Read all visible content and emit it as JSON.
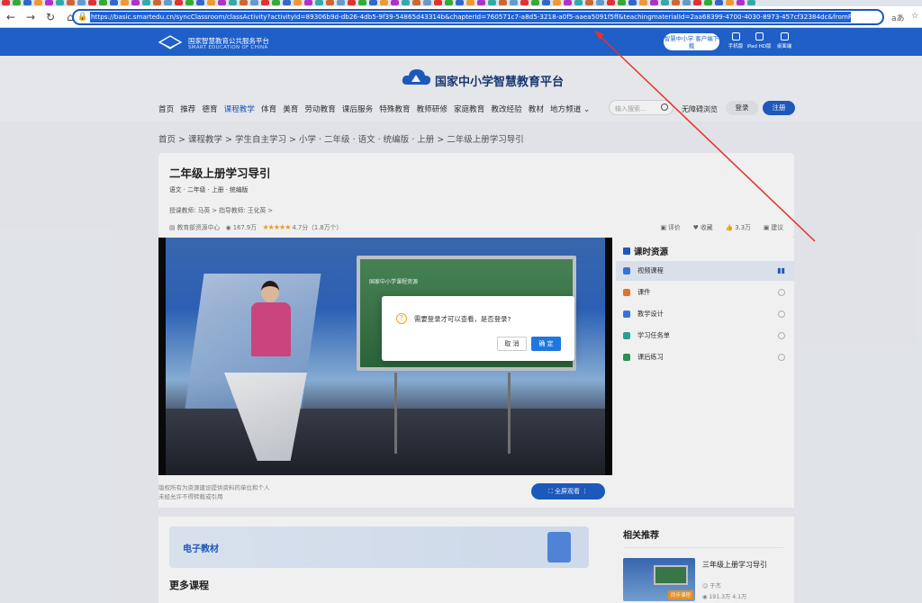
{
  "browser": {
    "url": "https://basic.smartedu.cn/syncClassroom/classActivity?activityId=89306b9d-db26-4db5-9f39-54865d43314b&chapterId=760571c7-a8d5-3218-a0f5-aaea5091f5ff&teachingmaterialId=2aa68399-4700-4030-8973-457cf32384dc&fromPrepare=0&classHourId=lesson_1",
    "read_aloud": "aあ",
    "tab_colors": [
      "#d33",
      "#3a3",
      "#36c",
      "#e93",
      "#a3c",
      "#3aa",
      "#c63",
      "#69c"
    ]
  },
  "topband": {
    "platform_name": "国家智慧教育公共服务平台",
    "platform_en": "SMART EDUCATION OF CHINA",
    "download_btn": "智慧中小学 客户端下载",
    "devices": [
      "手机版",
      "iPad HD版",
      "桌面端"
    ]
  },
  "header": {
    "site_title": "国家中小学智慧教育平台",
    "nav": [
      "首页",
      "推荐",
      "德育",
      "课程教学",
      "体育",
      "美育",
      "劳动教育",
      "课后服务",
      "特殊教育",
      "教师研修",
      "家庭教育",
      "教改经验",
      "教材",
      "地方频道 ⌄"
    ],
    "nav_active_index": 3,
    "search_placeholder": "输入搜索...",
    "accessible": "无障碍浏览",
    "login": "登录",
    "register": "注册"
  },
  "breadcrumb": "首页 > 课程教学 > 学生自主学习 > 小学 · 二年级 · 语文 · 统编版 · 上册 > 二年级上册学习导引",
  "course": {
    "title": "二年级上册学习导引",
    "subtitle": "语文 · 二年级 · 上册 · 统编版",
    "teachers": "授课教师:  马英 >      指导教师:  王化英 >",
    "source": "教育部资源中心",
    "views": "167.9万",
    "stars": "★★★★★",
    "rating": "4.7分（1.8万个）",
    "actions": [
      "评价",
      "收藏",
      "3.3万",
      "建议"
    ]
  },
  "video": {
    "board_text": "国家中小学课程资源",
    "copyright_line1": "版权所有为资源建设提供资料的单位和个人",
    "copyright_line2": "未经允许不得转载或引用",
    "fullscreen": "全屏观看 ⋮"
  },
  "sidebar": {
    "title": "课时资源",
    "items": [
      {
        "label": "视频课程",
        "color": "#3b7be0"
      },
      {
        "label": "课件",
        "color": "#f07a2a"
      },
      {
        "label": "教学设计",
        "color": "#3b7be0"
      },
      {
        "label": "学习任务单",
        "color": "#2fa8a0"
      },
      {
        "label": "课后练习",
        "color": "#2f9a5a"
      }
    ]
  },
  "textbook": {
    "banner": "电子教材",
    "more": "更多课程"
  },
  "related": {
    "title": "相关推荐",
    "item_title": "三年级上册学习导引",
    "item_badge": "同步课程",
    "item_author": "于杰",
    "item_views": "191.3万   4.1万"
  },
  "dialog": {
    "message": "需要登录才可以查看，是否登录?",
    "cancel": "取 消",
    "ok": "确 定"
  }
}
